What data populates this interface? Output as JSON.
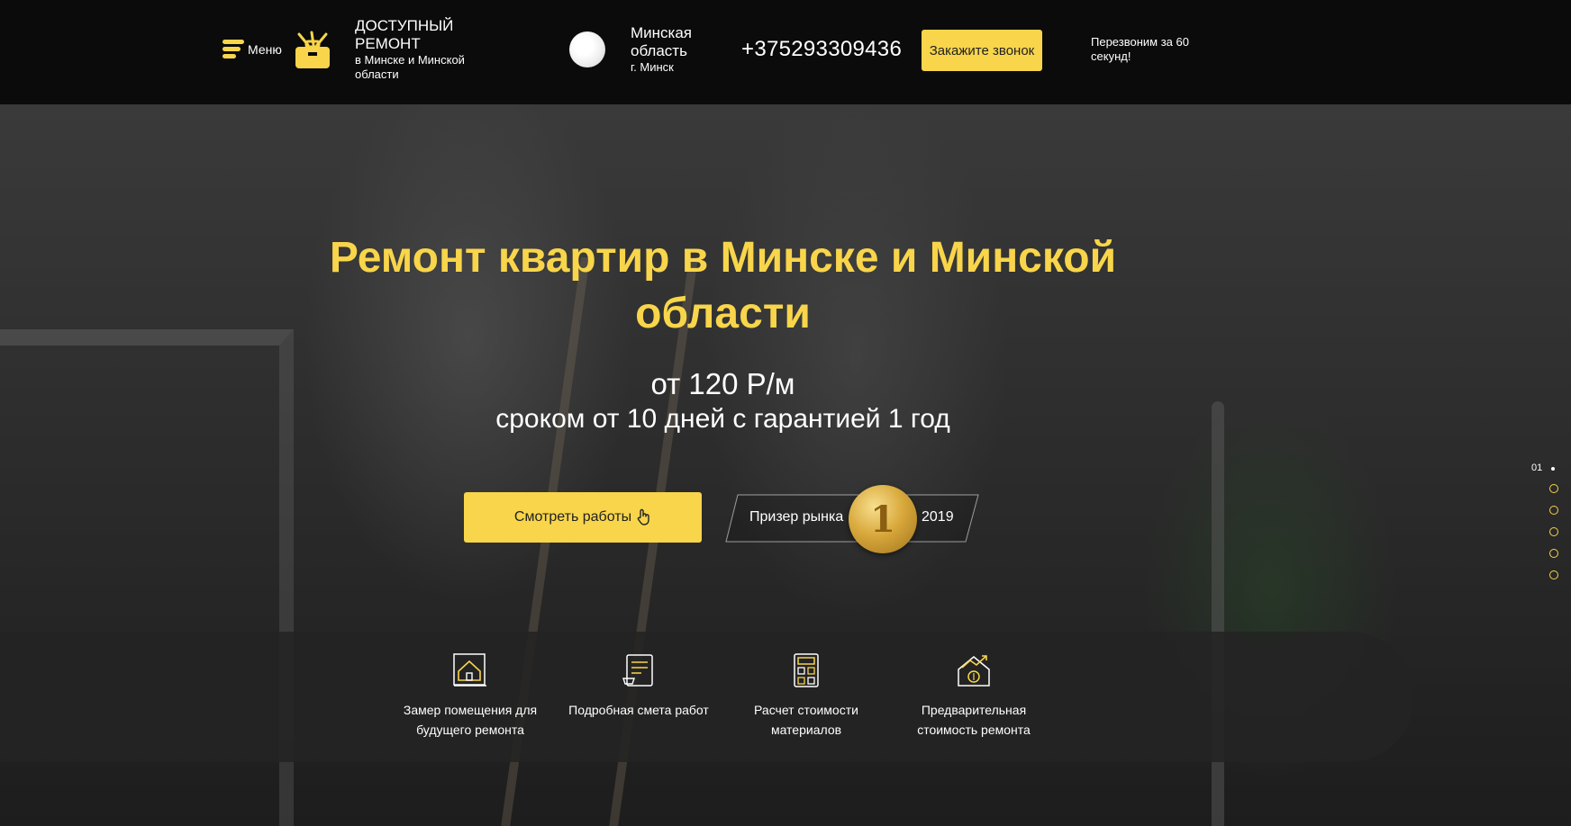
{
  "header": {
    "menu_label": "Меню",
    "brand_title": "ДОСТУПНЫЙ РЕМОНТ",
    "brand_subtitle": "в Минске и Минской области",
    "region_title": "Минская область",
    "region_city": "г. Минск",
    "phone": "+375293309436",
    "call_button": "Закажите звонок",
    "callback_note": "Перезвоним за 60 секунд!"
  },
  "hero": {
    "title": "Ремонт квартир в Минске и Минской области",
    "price": "от 120 Р/м",
    "terms": "сроком от 10 дней с гарантией 1 год",
    "works_button": "Смотреть работы",
    "award_label": "Призер рынка",
    "award_place": "1",
    "award_year": "2019"
  },
  "slider": {
    "current": "01",
    "total_dots": 5
  },
  "features": [
    {
      "icon": "house-plan-icon",
      "text": "Замер помещения для будущего ремонта"
    },
    {
      "icon": "estimate-document-icon",
      "text": "Подробная смета работ"
    },
    {
      "icon": "calculator-icon",
      "text": "Расчет стоимости материалов"
    },
    {
      "icon": "house-price-growth-icon",
      "text": "Предварительная стоимость ремонта"
    }
  ],
  "colors": {
    "accent": "#f8d54a",
    "header_bg": "#0b0b0b"
  }
}
